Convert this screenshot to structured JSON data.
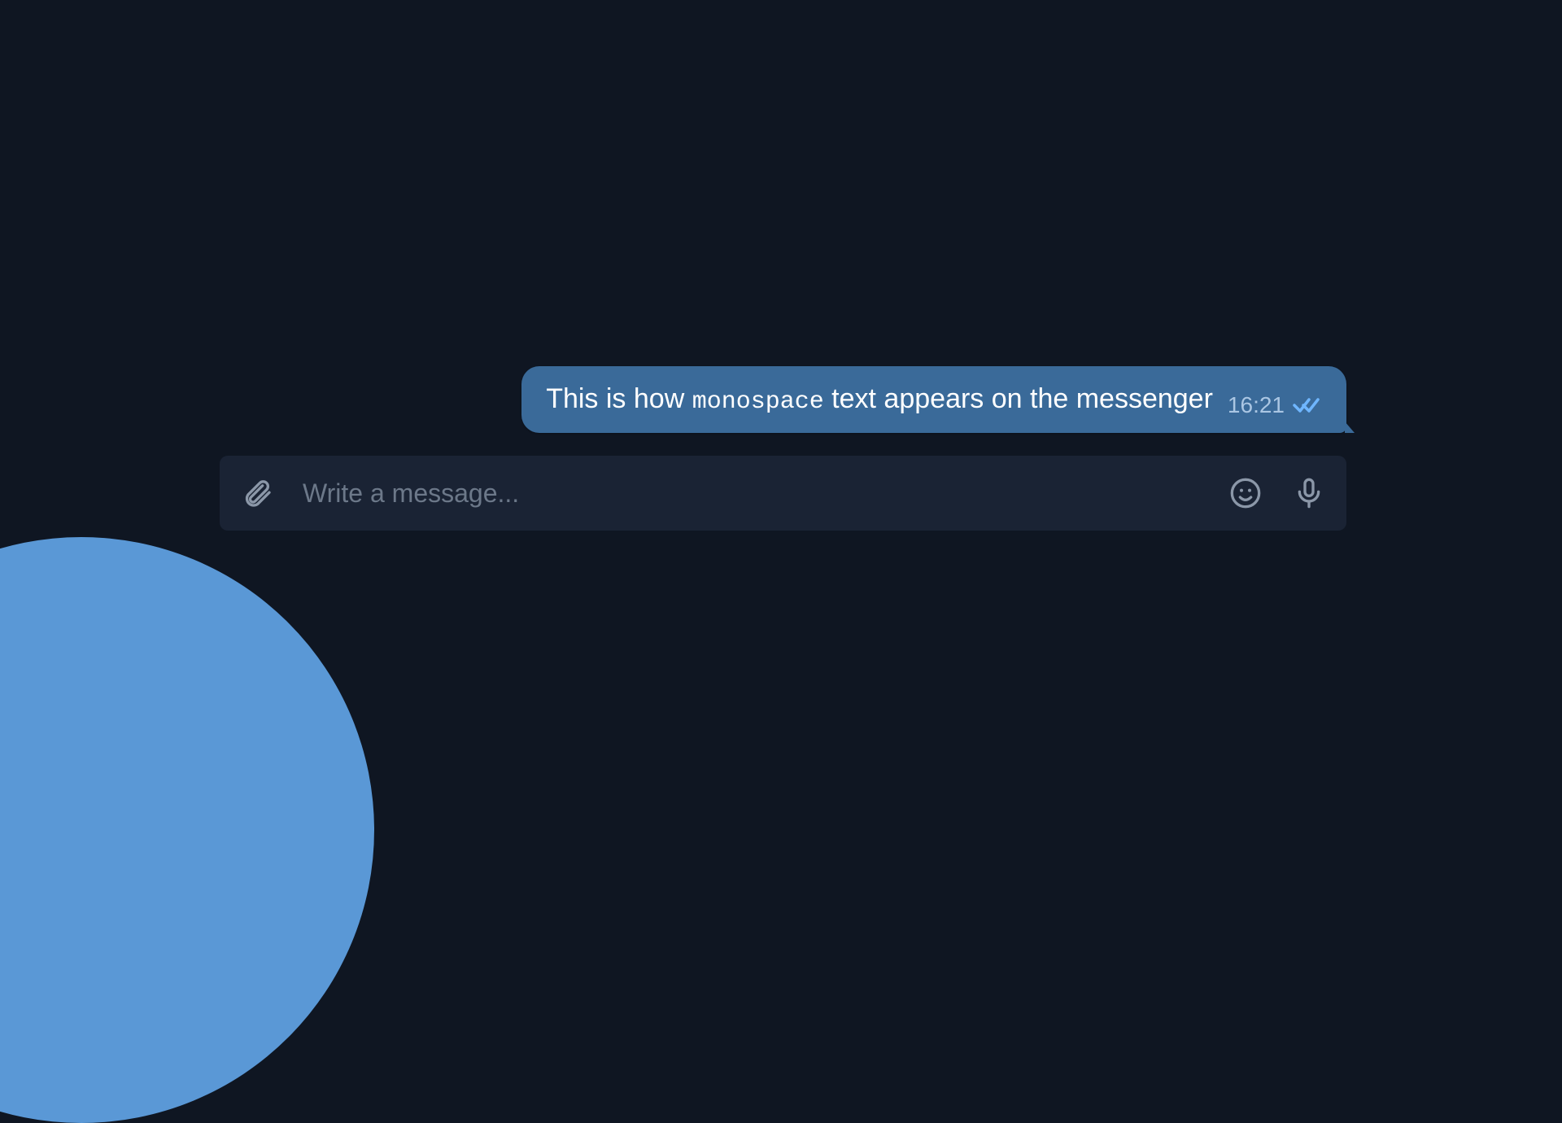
{
  "message": {
    "text_before": "This is how ",
    "text_mono": "monospace",
    "text_after": " text appears on the messenger",
    "time": "16:21",
    "read_status": "read"
  },
  "composer": {
    "placeholder": "Write a message..."
  },
  "icons": {
    "attach": "paperclip-icon",
    "emoji": "smile-icon",
    "mic": "mic-icon",
    "ticks": "double-check-icon"
  },
  "colors": {
    "bg": "#0f1622",
    "bubble": "#3a6a99",
    "input_bg": "#1a2334",
    "accent_circle": "#5a98d6",
    "meta": "#aac6e3",
    "icon": "#8b97a8",
    "tick": "#6fb6ff"
  }
}
